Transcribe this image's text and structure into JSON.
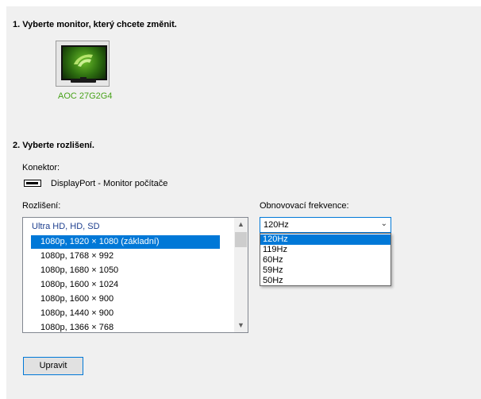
{
  "section1": {
    "title": "1. Vyberte monitor, který chcete změnit."
  },
  "monitor": {
    "name": "AOC 27G2G4"
  },
  "section2": {
    "title": "2. Vyberte rozlišení."
  },
  "connector": {
    "label": "Konektor:",
    "value": "DisplayPort - Monitor počítače"
  },
  "resolution": {
    "label": "Rozlišení:",
    "group_header": "Ultra HD, HD, SD",
    "items": [
      "1080p, 1920 × 1080 (základní)",
      "1080p, 1768 × 992",
      "1080p, 1680 × 1050",
      "1080p, 1600 × 1024",
      "1080p, 1600 × 900",
      "1080p, 1440 × 900",
      "1080p, 1366 × 768"
    ],
    "selected_index": 0
  },
  "refresh": {
    "label": "Obnovovací frekvence:",
    "selected": "120Hz",
    "options": [
      "120Hz",
      "119Hz",
      "60Hz",
      "59Hz",
      "50Hz"
    ]
  },
  "buttons": {
    "apply": "Upravit"
  },
  "colors": {
    "accent": "#0078d7",
    "brand_green": "#48a21a"
  }
}
